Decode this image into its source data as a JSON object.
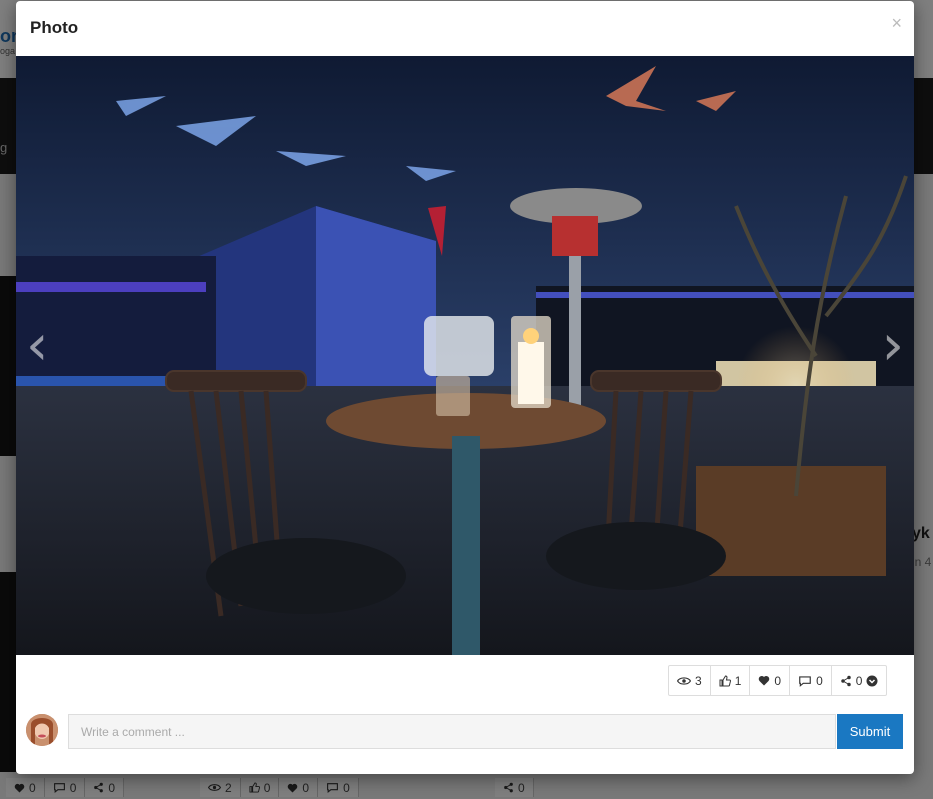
{
  "background": {
    "logo_text": "on",
    "logo_sub": "oga",
    "dark_bar_text": "g",
    "side_title": "yk",
    "side_sub": "in 4",
    "stats_left": [
      "0",
      "0",
      "0"
    ],
    "stats_mid": [
      "2",
      "0",
      "0",
      "0"
    ],
    "stats_right": [
      "0"
    ]
  },
  "modal": {
    "title": "Photo",
    "close_label": "×",
    "prev_label": "‹",
    "next_label": "›",
    "stats": {
      "views": "3",
      "likes": "1",
      "loves": "0",
      "comments": "0",
      "shares": "0"
    },
    "comment": {
      "placeholder": "Write a comment ...",
      "submit_label": "Submit"
    }
  },
  "colors": {
    "accent": "#1a78c2",
    "overlay": "rgba(0,0,0,0.5)"
  }
}
